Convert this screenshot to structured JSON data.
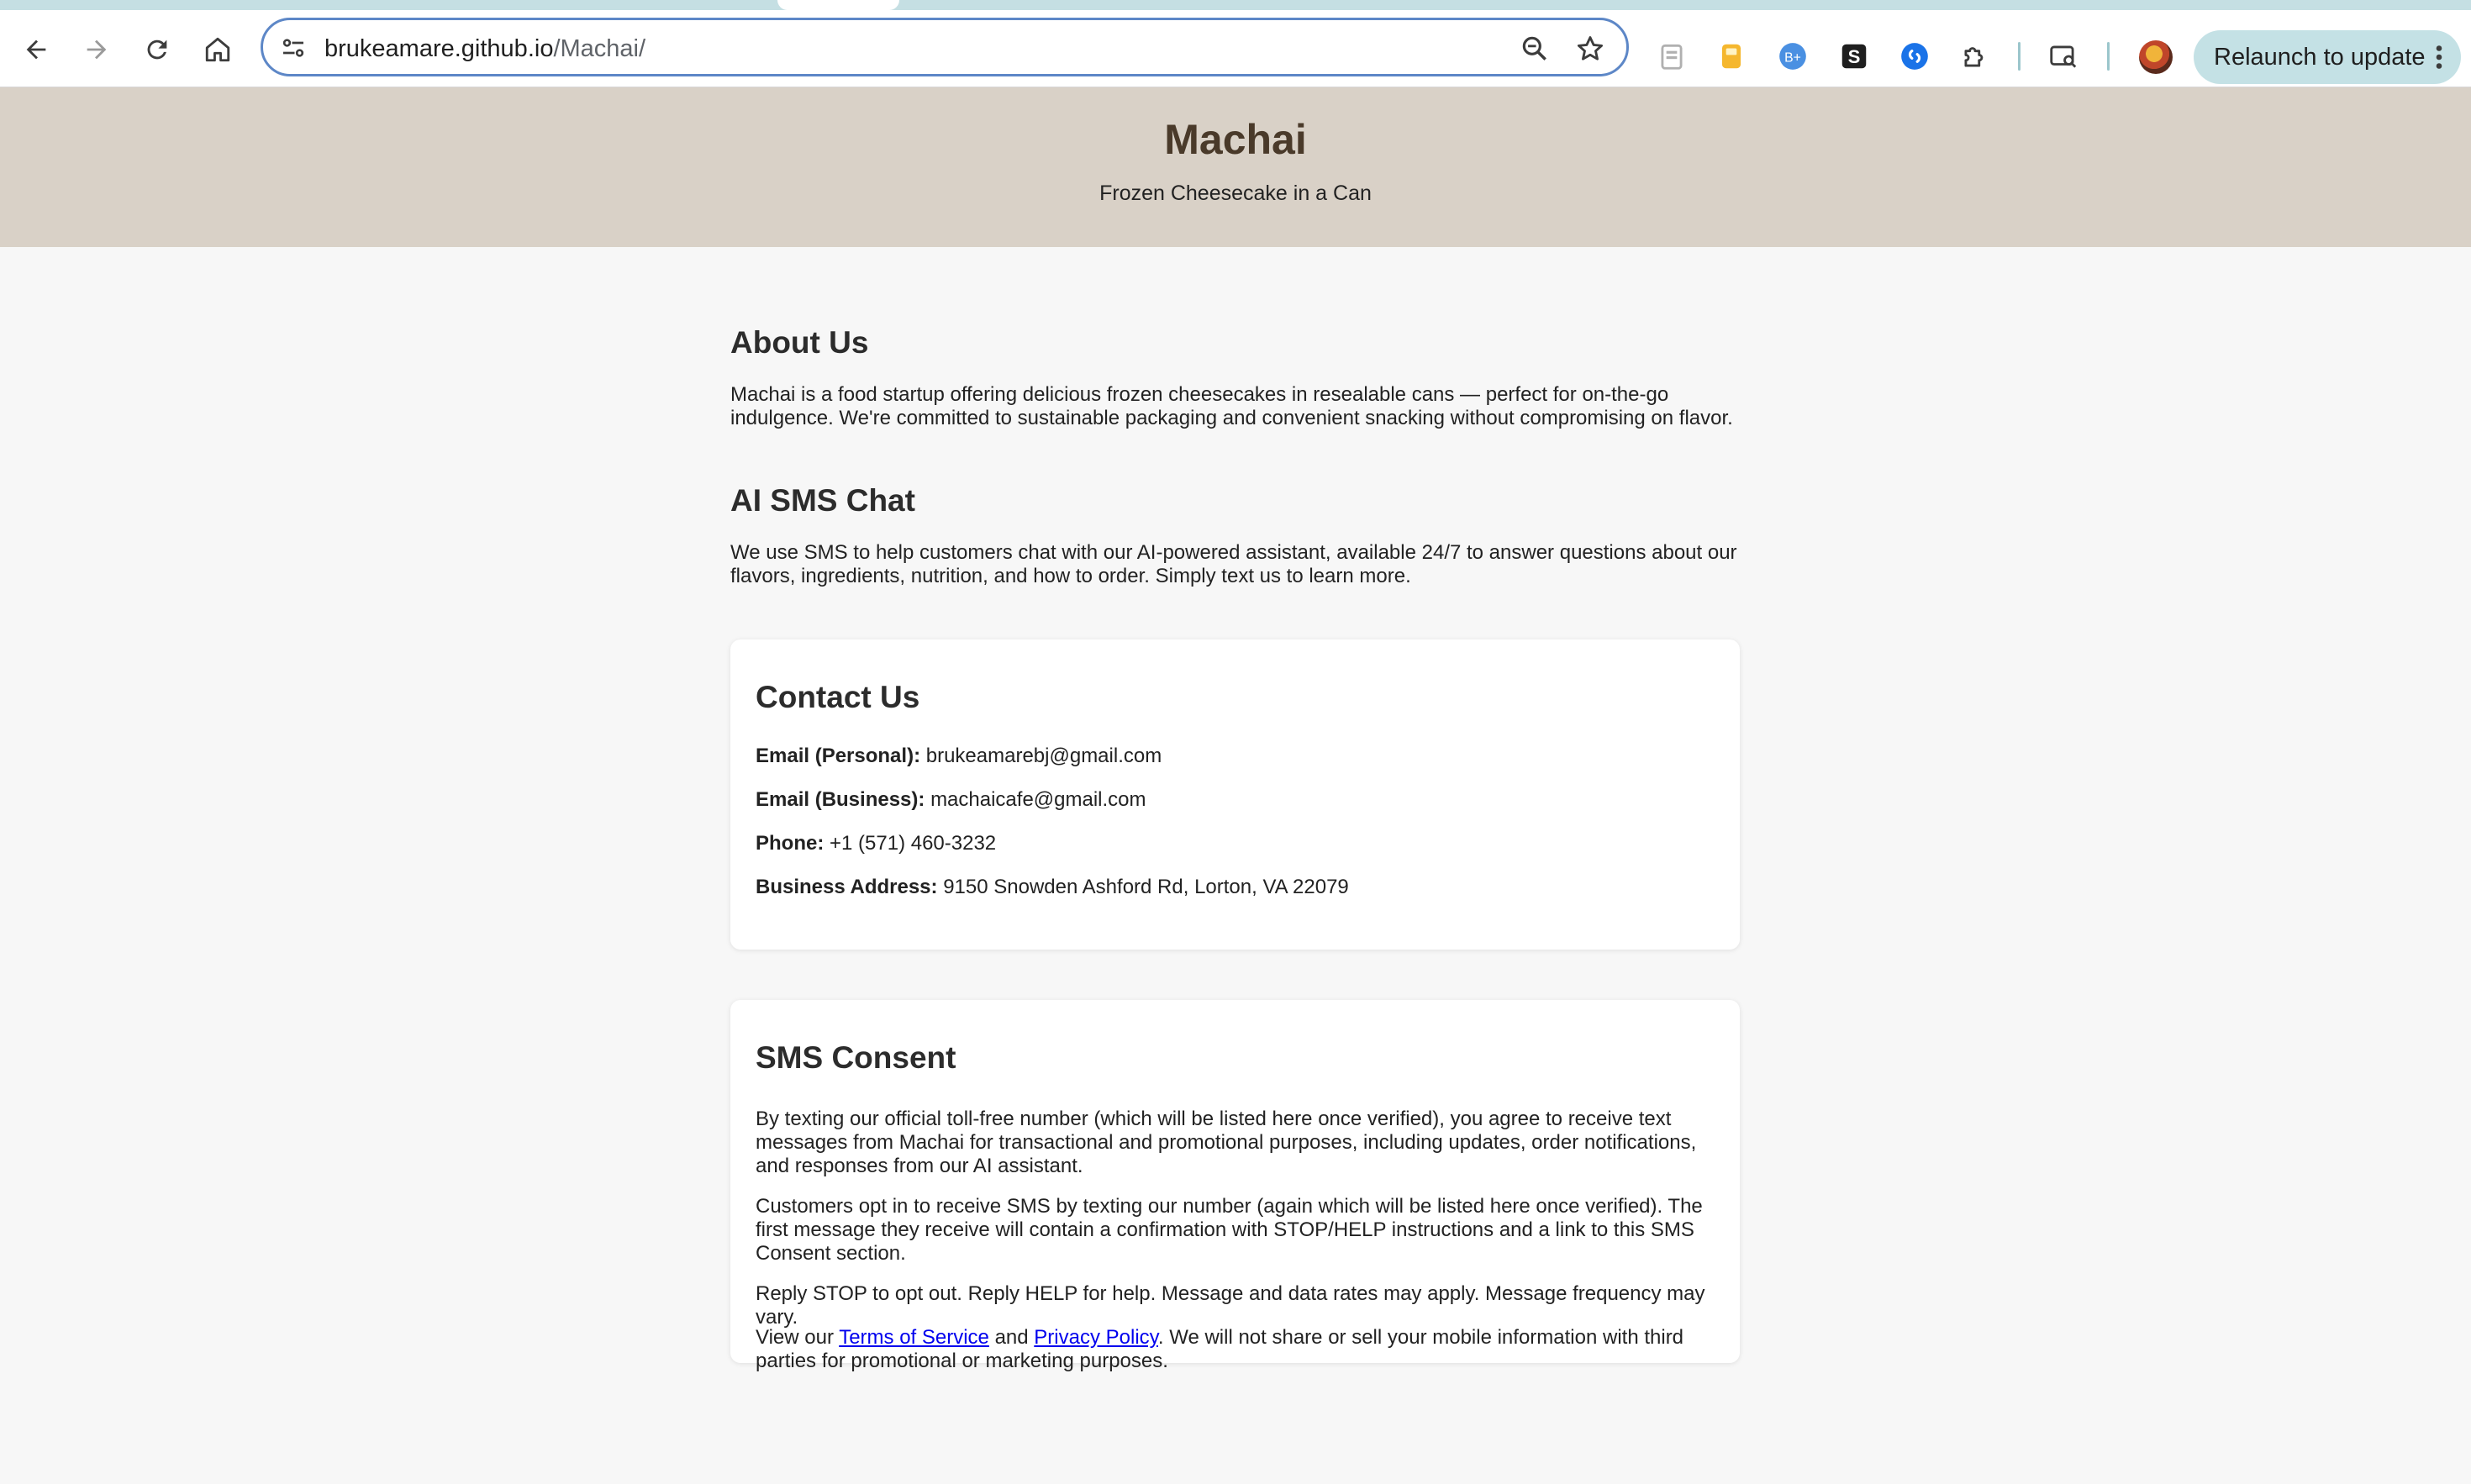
{
  "browser": {
    "url_host": "brukeamare.github.io",
    "url_path": "/Machai/",
    "relaunch_label": "Relaunch to update"
  },
  "header": {
    "title": "Machai",
    "tagline": "Frozen Cheesecake in a Can"
  },
  "about": {
    "heading": "About Us",
    "body": "Machai is a food startup offering delicious frozen cheesecakes in resealable cans — perfect for on-the-go indulgence. We're committed to sustainable packaging and convenient snacking without compromising on flavor."
  },
  "ai_chat": {
    "heading": "AI SMS Chat",
    "body": "We use SMS to help customers chat with our AI-powered assistant, available 24/7 to answer questions about our flavors, ingredients, nutrition, and how to order. Simply text us to learn more."
  },
  "contact": {
    "heading": "Contact Us",
    "email_personal_label": "Email (Personal):",
    "email_personal": "brukeamarebj@gmail.com",
    "email_business_label": "Email (Business):",
    "email_business": "machaicafe@gmail.com",
    "phone_label": "Phone:",
    "phone": "+1 (571) 460-3232",
    "address_label": "Business Address:",
    "address": "9150 Snowden Ashford Rd, Lorton, VA 22079"
  },
  "sms_consent": {
    "heading": "SMS Consent",
    "p1": "By texting our official toll-free number (which will be listed here once verified), you agree to receive text messages from Machai for transactional and promotional purposes, including updates, order notifications, and responses from our AI assistant.",
    "p2": "Customers opt in to receive SMS by texting our number (again which will be listed here once verified). The first message they receive will contain a confirmation with STOP/HELP instructions and a link to this SMS Consent section.",
    "p3": "Reply STOP to opt out. Reply HELP for help. Message and data rates may apply. Message frequency may vary.",
    "p4_prefix": "View our ",
    "terms_link": "Terms of Service",
    "p4_and": " and ",
    "privacy_link": "Privacy Policy",
    "p4_suffix": ". We will not share or sell your mobile information with third parties for promotional or marketing purposes."
  },
  "colors": {
    "header_bg": "#d9d1c7",
    "title_color": "#4a3a2a",
    "page_bg": "#f7f7f7",
    "link": "#0000ee",
    "omnibox_focus": "#5d87c7",
    "relaunch_bg": "#c4e1e5"
  },
  "icons": [
    "back-icon",
    "forward-icon",
    "reload-icon",
    "home-icon",
    "site-settings-icon",
    "zoom-icon",
    "bookmark-star-icon",
    "extension-icons",
    "puzzle-icon",
    "tab-search-icon",
    "profile-avatar",
    "kebab-menu-icon"
  ]
}
